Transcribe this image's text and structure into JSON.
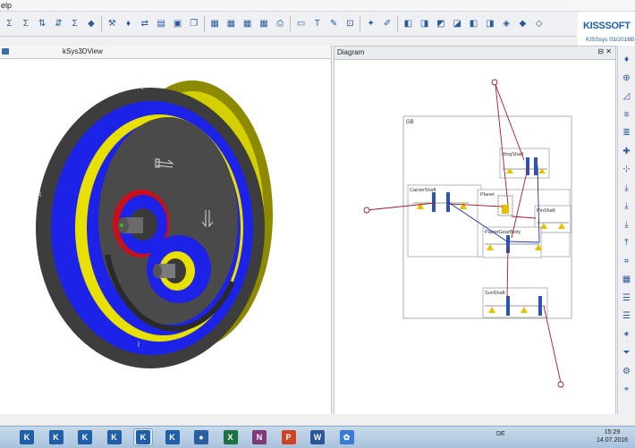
{
  "menu": {
    "help_fragment": "elp"
  },
  "logo": {
    "brand_left": "KISS",
    "brand_right": "SOFT",
    "version": "KISSsys 03/2016B"
  },
  "view3d": {
    "tab_title": "kSys3DView"
  },
  "diagram": {
    "title": "Diagram",
    "window_buttons": "⊟ ✕",
    "labels": {
      "gb": "GB",
      "ring_shaft": "RingShaft",
      "carrier_shaft": "CarrierShaft",
      "planet": "Planet",
      "pin_shaft": "PinShaft",
      "planet_gear_body": "PlanetGearBody",
      "sun_shaft": "SunShaft"
    }
  },
  "toolbar_icons": [
    "sigma-icon",
    "sum-icon",
    "sort-asc-icon",
    "sort-desc-icon",
    "sort-sigma-icon",
    "sigma-diamond-icon",
    "sep",
    "tool-icon",
    "lamp-icon",
    "arrow-move-icon",
    "open-folder-icon",
    "save-icon",
    "copy-icon",
    "sep",
    "table-icon",
    "table2-icon",
    "table3-icon",
    "table4-icon",
    "print-icon",
    "sep",
    "text-box-icon",
    "text-icon",
    "edit-icon",
    "pick-icon",
    "sep",
    "wand-icon",
    "pen-icon",
    "sep",
    "cube1-icon",
    "cube2-icon",
    "cube3-icon",
    "cube4-icon",
    "cube5-icon",
    "cube6-icon",
    "diamond1-icon",
    "diamond2-icon",
    "diamond3-icon"
  ],
  "side_icons": [
    "lamp-icon",
    "orbit-icon",
    "tilt-icon",
    "align-icon",
    "align2-icon",
    "axis-icon",
    "axis2-icon",
    "download-icon",
    "download2-icon",
    "download3-icon",
    "upload-icon",
    "measure-icon",
    "grid-icon",
    "menu-icon",
    "menu2-icon",
    "star-icon",
    "funnel-icon",
    "settings-icon",
    "pin-icon"
  ],
  "taskbar": {
    "apps": [
      {
        "name": "kisssoft-1",
        "glyph": "K",
        "color": "#1f5fa8",
        "active": false
      },
      {
        "name": "kisssoft-2",
        "glyph": "K",
        "color": "#1f5fa8",
        "active": false
      },
      {
        "name": "kisssoft-3",
        "glyph": "K",
        "color": "#1f5fa8",
        "active": false
      },
      {
        "name": "kisssoft-4",
        "glyph": "K",
        "color": "#1f5fa8",
        "active": false
      },
      {
        "name": "kisssoft-5",
        "glyph": "K",
        "color": "#1f5fa8",
        "active": true
      },
      {
        "name": "kisssoft-6",
        "glyph": "K",
        "color": "#1f5fa8",
        "active": false
      },
      {
        "name": "browser",
        "glyph": "●",
        "color": "#2a5fa0",
        "active": false
      },
      {
        "name": "excel",
        "glyph": "X",
        "color": "#1e7145",
        "active": false
      },
      {
        "name": "onenote",
        "glyph": "N",
        "color": "#80397b",
        "active": false
      },
      {
        "name": "powerpoint",
        "glyph": "P",
        "color": "#d04423",
        "active": false
      },
      {
        "name": "word",
        "glyph": "W",
        "color": "#2b579a",
        "active": false
      },
      {
        "name": "other-app",
        "glyph": "✿",
        "color": "#3a7bd5",
        "active": false
      }
    ],
    "language": "DE",
    "time": "15:29",
    "date": "14.07.2016"
  },
  "colors": {
    "gear_blue": "#1d22e8",
    "gear_yellow": "#e8e000",
    "housing_dark": "#3d3d3d",
    "housing_olive": "#8d8a00",
    "ring_red": "#c8101a",
    "diagram_red": "#b0182a",
    "diagram_blue": "#2030c0"
  }
}
